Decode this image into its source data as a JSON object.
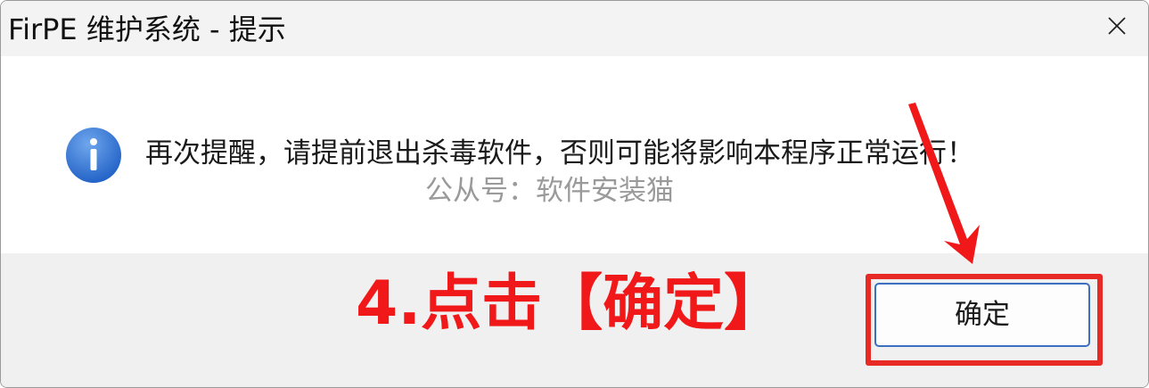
{
  "window": {
    "title": "FirPE 维护系统 - 提示"
  },
  "dialog": {
    "message": "再次提醒，请提前退出杀毒软件，否则可能将影响本程序正常运行！",
    "watermark": "公从号：软件安装猫",
    "ok_label": "确定"
  },
  "annotation": {
    "step_text": "4.点击【确定】",
    "color": "#f01818"
  },
  "icons": {
    "info": "info-icon",
    "close": "close-icon",
    "arrow": "arrow-icon"
  }
}
